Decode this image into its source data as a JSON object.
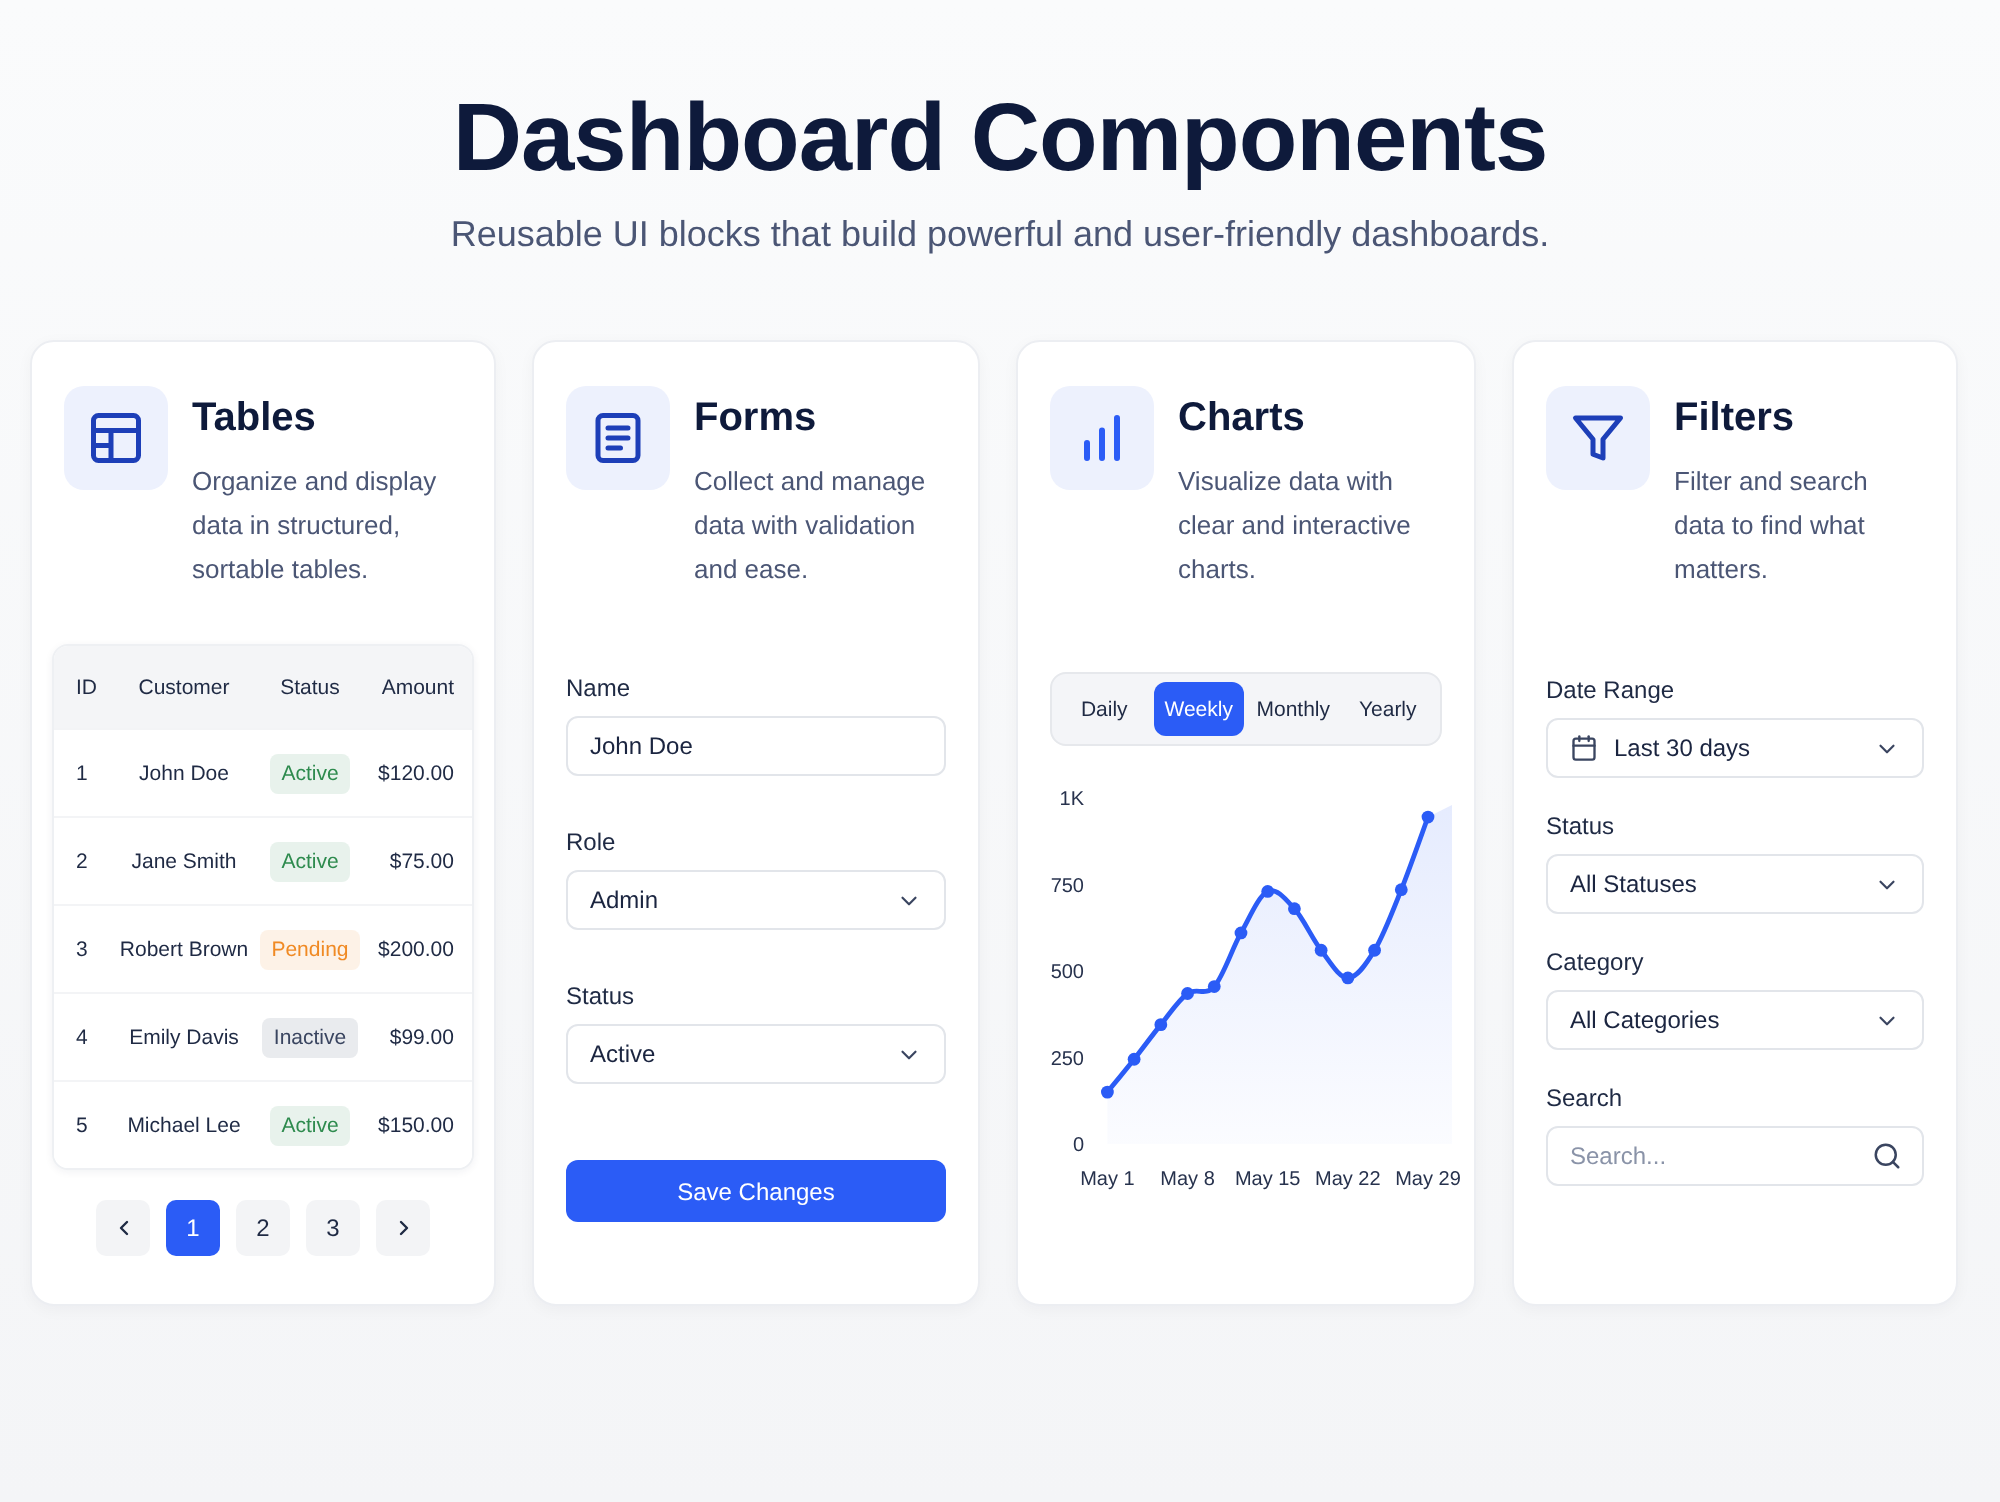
{
  "header": {
    "title": "Dashboard Components",
    "subtitle": "Reusable UI blocks that build powerful and user-friendly dashboards."
  },
  "cards": [
    {
      "kind": "table",
      "title": "Tables",
      "description": "Organize and display data in structured, sortable tables.",
      "table": {
        "columns": [
          "ID",
          "Customer",
          "Status",
          "Amount"
        ],
        "rows": [
          {
            "id": "1",
            "customer": "John Doe",
            "status": {
              "label": "Active",
              "color": "#2e8b4e"
            },
            "amount": "$120.00"
          },
          {
            "id": "2",
            "customer": "Jane Smith",
            "status": {
              "label": "Active",
              "color": "#2e8b4e"
            },
            "amount": "$75.00"
          },
          {
            "id": "3",
            "customer": "Robert Brown",
            "status": {
              "label": "Pending",
              "color": "#f08a24"
            },
            "amount": "$200.00"
          },
          {
            "id": "4",
            "customer": "Emily Davis",
            "status": {
              "label": "Inactive",
              "color": "#3a4560"
            },
            "amount": "$99.00"
          },
          {
            "id": "5",
            "customer": "Michael Lee",
            "status": {
              "label": "Active",
              "color": "#2e8b4e"
            },
            "amount": "$150.00"
          }
        ]
      },
      "pagination": {
        "pages": [
          {
            "label": "1",
            "selected": true
          },
          {
            "label": "2",
            "selected": false
          },
          {
            "label": "3",
            "selected": false
          }
        ]
      }
    },
    {
      "kind": "form",
      "title": "Forms",
      "description": "Collect and manage data with validation and ease.",
      "fields": [
        {
          "kind": "text",
          "label": "Name",
          "value": "John Doe"
        },
        {
          "kind": "select",
          "label": "Role",
          "value": "Admin"
        },
        {
          "kind": "select",
          "label": "Status",
          "value": "Active"
        }
      ],
      "button": "Save Changes"
    },
    {
      "kind": "chart",
      "title": "Charts",
      "description": "Visualize data with clear and interactive charts.",
      "periods": [
        {
          "label": "Daily",
          "selected": false
        },
        {
          "label": "Weekly",
          "selected": true
        },
        {
          "label": "Monthly",
          "selected": false
        },
        {
          "label": "Yearly",
          "selected": false
        }
      ],
      "chart_data": {
        "type": "area",
        "categories": [
          "May 1",
          null,
          null,
          "May 8",
          null,
          null,
          "May 15",
          null,
          null,
          "May 22",
          null,
          null,
          "May 29"
        ],
        "series": [
          {
            "color": "#2b5cf6",
            "values": [
              150,
              245,
              345,
              435,
              455,
              610,
              730,
              680,
              560,
              480,
              560,
              735,
              945
            ]
          }
        ],
        "ylim": [
          0,
          1000
        ],
        "yticks": [
          0,
          250,
          500,
          750,
          {
            "value": 1000,
            "label": "1K"
          }
        ]
      }
    },
    {
      "kind": "filter",
      "title": "Filters",
      "description": "Filter and search data to find what matters.",
      "fields": [
        {
          "kind": "date",
          "label": "Date Range",
          "value": "Last 30 days"
        },
        {
          "kind": "select",
          "label": "Status",
          "value": "All Statuses"
        },
        {
          "kind": "select",
          "label": "Category",
          "value": "All Categories"
        },
        {
          "kind": "search",
          "label": "Search",
          "placeholder": "Search..."
        }
      ]
    }
  ]
}
